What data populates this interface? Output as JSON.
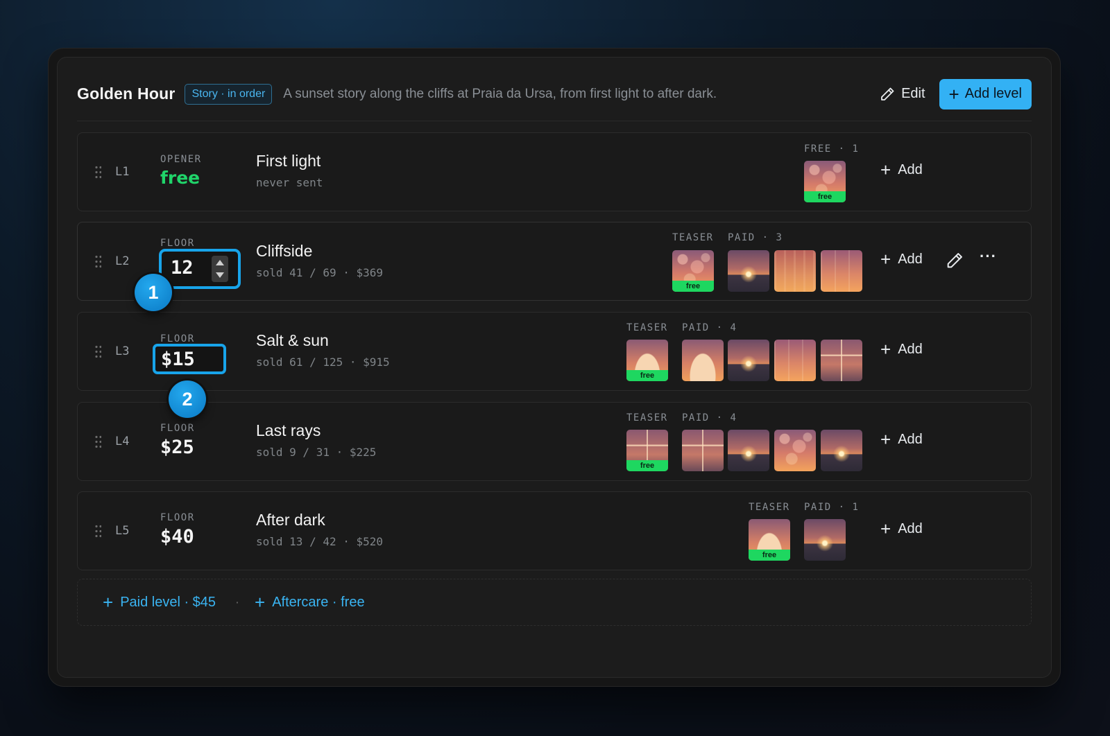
{
  "header": {
    "title": "Golden Hour",
    "mode_badge": "Story · in order",
    "description": "A sunset story along the cliffs at Praia da Ursa, from first light to after dark.",
    "edit_label": "Edit",
    "add_level_label": "Add level"
  },
  "levels": [
    {
      "id": "L1",
      "kind_label": "OPENER",
      "price": "free",
      "name": "First light",
      "stats": "never sent",
      "groups": [
        {
          "label": "FREE · 1"
        }
      ],
      "add_label": "Add"
    },
    {
      "id": "L2",
      "kind_label": "FLOOR",
      "price": "12",
      "name": "Cliffside",
      "stats": "sold 41 / 69 · $369",
      "groups": [
        {
          "label": "TEASER"
        },
        {
          "label": "PAID · 3"
        }
      ],
      "add_label": "Add"
    },
    {
      "id": "L3",
      "kind_label": "FLOOR",
      "price": "$15",
      "name": "Salt & sun",
      "stats": "sold 61 / 125 · $915",
      "groups": [
        {
          "label": "TEASER"
        },
        {
          "label": "PAID · 4"
        }
      ],
      "add_label": "Add"
    },
    {
      "id": "L4",
      "kind_label": "FLOOR",
      "price": "$25",
      "name": "Last rays",
      "stats": "sold 9 / 31 · $225",
      "groups": [
        {
          "label": "TEASER"
        },
        {
          "label": "PAID · 4"
        }
      ],
      "add_label": "Add"
    },
    {
      "id": "L5",
      "kind_label": "FLOOR",
      "price": "$40",
      "name": "After dark",
      "stats": "sold 13 / 42 · $520",
      "groups": [
        {
          "label": "TEASER"
        },
        {
          "label": "PAID · 1"
        }
      ],
      "add_label": "Add"
    }
  ],
  "free_tag": "free",
  "markers": [
    "1",
    "2"
  ],
  "footer": {
    "paid_level_label": "Paid level · $45",
    "separator": "·",
    "aftercare_label": "Aftercare · free"
  },
  "icons": {
    "edit": "pencil-icon",
    "add": "plus-icon",
    "drag": "drag-handle-icon",
    "more": "more-horizontal-icon"
  },
  "colors": {
    "accent": "#33b1f4",
    "free_green": "#20d46a",
    "focus_ring": "#18a4ea"
  }
}
